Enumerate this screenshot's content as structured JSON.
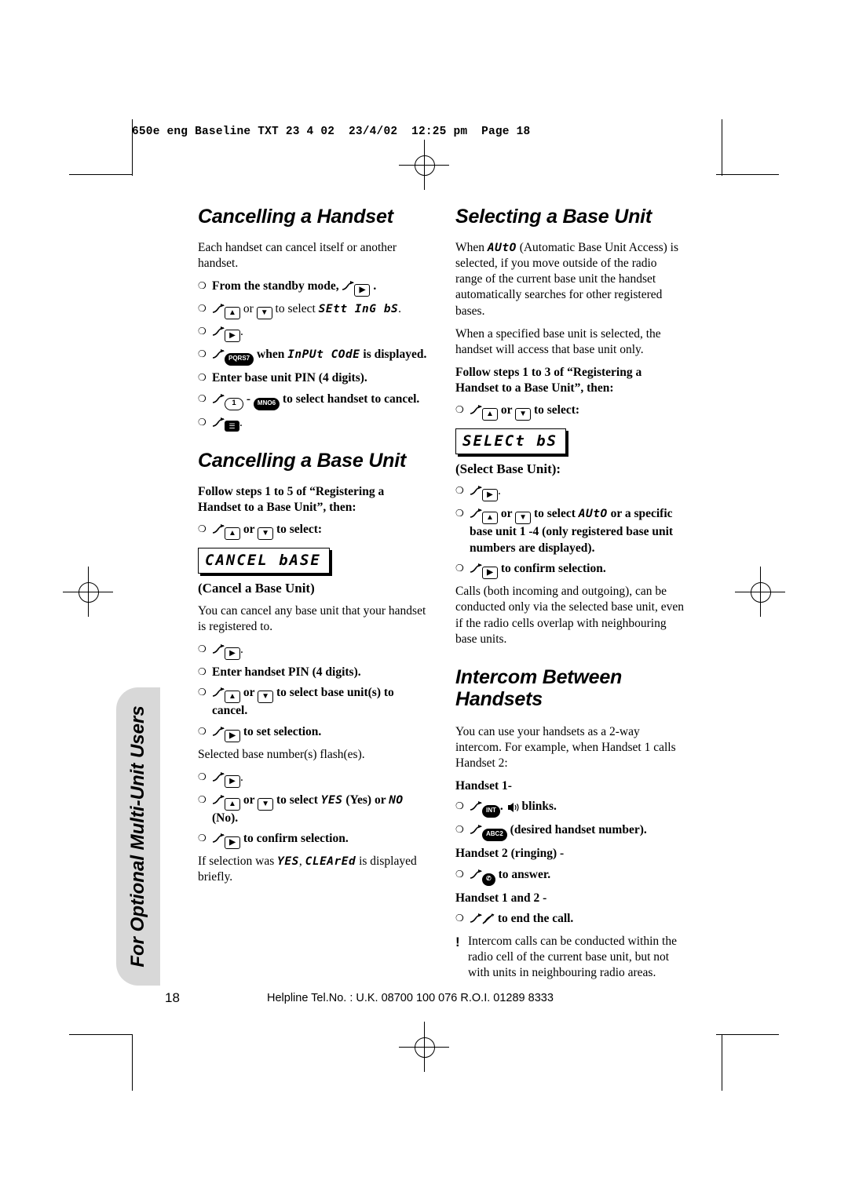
{
  "slug": "650e eng Baseline TXT 23 4 02  23/4/02  12:25 pm  Page 18",
  "side_tab": "For Optional Multi-Unit Users",
  "footer": {
    "page_number": "18",
    "helpline": "Helpline Tel.No. : U.K. 08700 100 076   R.O.I. 01289 8333"
  },
  "left_column": {
    "section1": {
      "title": "Cancelling a Handset",
      "intro": "Each handset can cancel itself or another handset.",
      "steps": [
        "From the standby mode,",
        "or  to select SEtt InG bS.",
        ".",
        "when InPUt COdE is displayed.",
        "Enter base unit PIN (4 digits).",
        "-  to select handset to cancel.",
        "."
      ],
      "lcd_setting": "SEtt InG bS",
      "lcd_input_code": "InPUt COdE"
    },
    "section2": {
      "title": "Cancelling a Base Unit",
      "lead": "Follow steps 1 to 5 of “Registering a Handset to a Base Unit”, then:",
      "step_select": "or  to select:",
      "lcd_box": "CANCEL bASE",
      "caption": "(Cancel a Base Unit)",
      "body1": "You can cancel any base unit that your handset is registered to.",
      "step_ok": ".",
      "step_pin": "Enter handset PIN (4 digits).",
      "step_updown": "or  to select base unit(s) to cancel.",
      "step_set": "to set selection.",
      "note_flash": "Selected base number(s) flash(es).",
      "step_ok2": ".",
      "step_yesno": "or  to select YES (Yes) or NO (No).",
      "lcd_yes": "YES",
      "lcd_no": "NO",
      "step_confirm": "to confirm selection.",
      "body2_a": "If selection was ",
      "body2_lcd1": "YES",
      "body2_b": ", ",
      "body2_lcd2": "CLEArEd",
      "body2_c": " is displayed briefly."
    }
  },
  "right_column": {
    "section1": {
      "title": "Selecting a Base Unit",
      "para1_a": "When ",
      "para1_lcd": "AUtO",
      "para1_b": " (Automatic Base Unit Access) is selected, if you move outside of the radio range of the current base unit the handset automatically searches for other registered bases.",
      "para2": "When a specified base unit is selected, the handset will access that base unit only.",
      "lead": "Follow steps 1 to 3 of “Registering a Handset to a Base Unit”, then:",
      "step_select": "or  to select:",
      "lcd_box": "SELECt bS",
      "caption": "(Select Base Unit):",
      "step_ok": ".",
      "step_auto": "or  to select AUtO or a specific base unit 1 -4 (only registered base unit numbers are displayed).",
      "lcd_auto": "AUtO",
      "step_confirm": "to confirm selection.",
      "para3": "Calls (both incoming and outgoing), can be conducted only via the selected base unit, even if the radio cells overlap with neighbouring base units."
    },
    "section2": {
      "title": "Intercom Between Handsets",
      "para1": "You can use your handsets as a 2-way intercom. For example, when Handset 1 calls Handset 2:",
      "label_h1": "Handset 1-",
      "step_int": ".  blinks.",
      "step_number": "(desired handset number).",
      "label_h2_ring": "Handset 2 (ringing) -",
      "step_answer": "to answer.",
      "label_h12": "Handset 1 and 2 -",
      "step_end": "to end the call.",
      "note": "Intercom calls can be conducted within the radio cell of the current base unit, but not with units in neighbouring radio areas."
    }
  },
  "keys": {
    "menu_arrow": "menu-key",
    "right_arrow_key": "right-arrow-key",
    "up_key": "up-arrow-key",
    "down_key": "down-arrow-key",
    "key_7": "7",
    "key_1": "1",
    "key_6": "6",
    "key_2": "2",
    "key_int": "INT",
    "book_key": "phonebook-key",
    "talk_key": "talk-key",
    "end_key": "end-call-key",
    "ring_icon": "ringing-icon"
  }
}
